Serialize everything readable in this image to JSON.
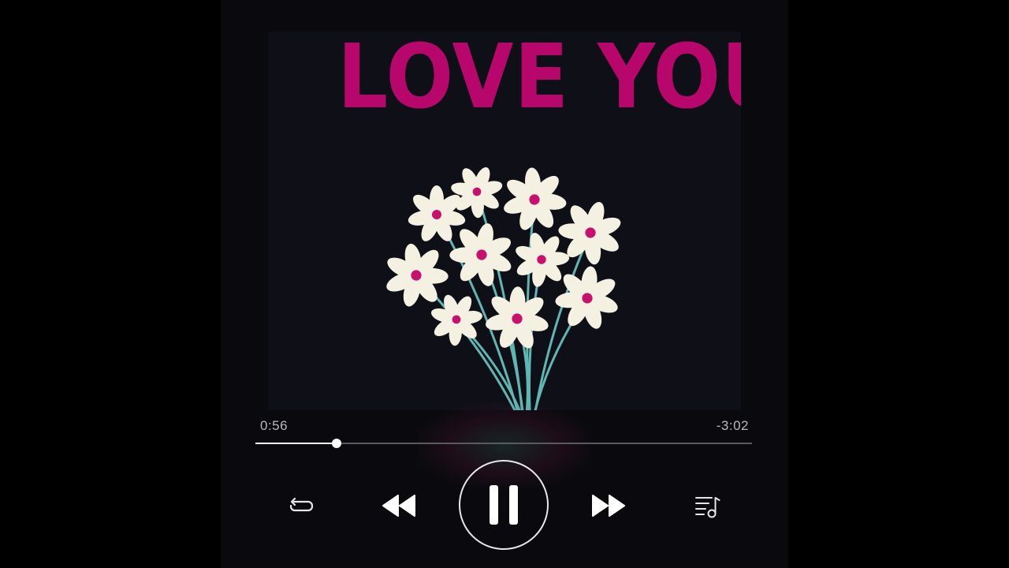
{
  "artwork": {
    "title": "LOVE YOU",
    "title_color": "#b8076c",
    "background": "#0f0f17",
    "petal_color": "#f4f0e2",
    "flower_center_color": "#c8106e",
    "stem_color": "#5fb7b4"
  },
  "playback": {
    "elapsed": "0:56",
    "remaining": "-3:02",
    "progress_fraction": 0.164,
    "state": "playing"
  },
  "controls": {
    "repeat_icon": "repeat-icon",
    "previous_icon": "rewind-icon",
    "play_pause_icon": "pause-icon",
    "next_icon": "fast-forward-icon",
    "queue_icon": "playlist-music-icon"
  },
  "colors": {
    "player_background": "#0a0a0e",
    "text_muted": "#b7b7bd",
    "track": "#5a5a60",
    "accent": "#ffffff"
  }
}
